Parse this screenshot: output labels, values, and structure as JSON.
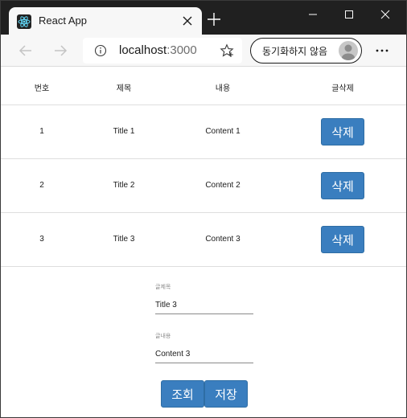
{
  "browser": {
    "tab_title": "React App",
    "url_host": "localhost",
    "url_port": ":3000",
    "sync_label": "동기화하지 않음",
    "accent_color": "#3a7ebf"
  },
  "table": {
    "headers": [
      "번호",
      "제목",
      "내용",
      "글삭제"
    ],
    "rows": [
      {
        "no": "1",
        "title": "Title 1",
        "content": "Content 1",
        "delete_label": "삭제"
      },
      {
        "no": "2",
        "title": "Title 2",
        "content": "Content 2",
        "delete_label": "삭제"
      },
      {
        "no": "3",
        "title": "Title 3",
        "content": "Content 3",
        "delete_label": "삭제"
      }
    ]
  },
  "form": {
    "title_label": "글제목",
    "title_value": "Title 3",
    "content_label": "글내용",
    "content_value": "Content 3",
    "view_label": "조회",
    "save_label": "저장"
  }
}
